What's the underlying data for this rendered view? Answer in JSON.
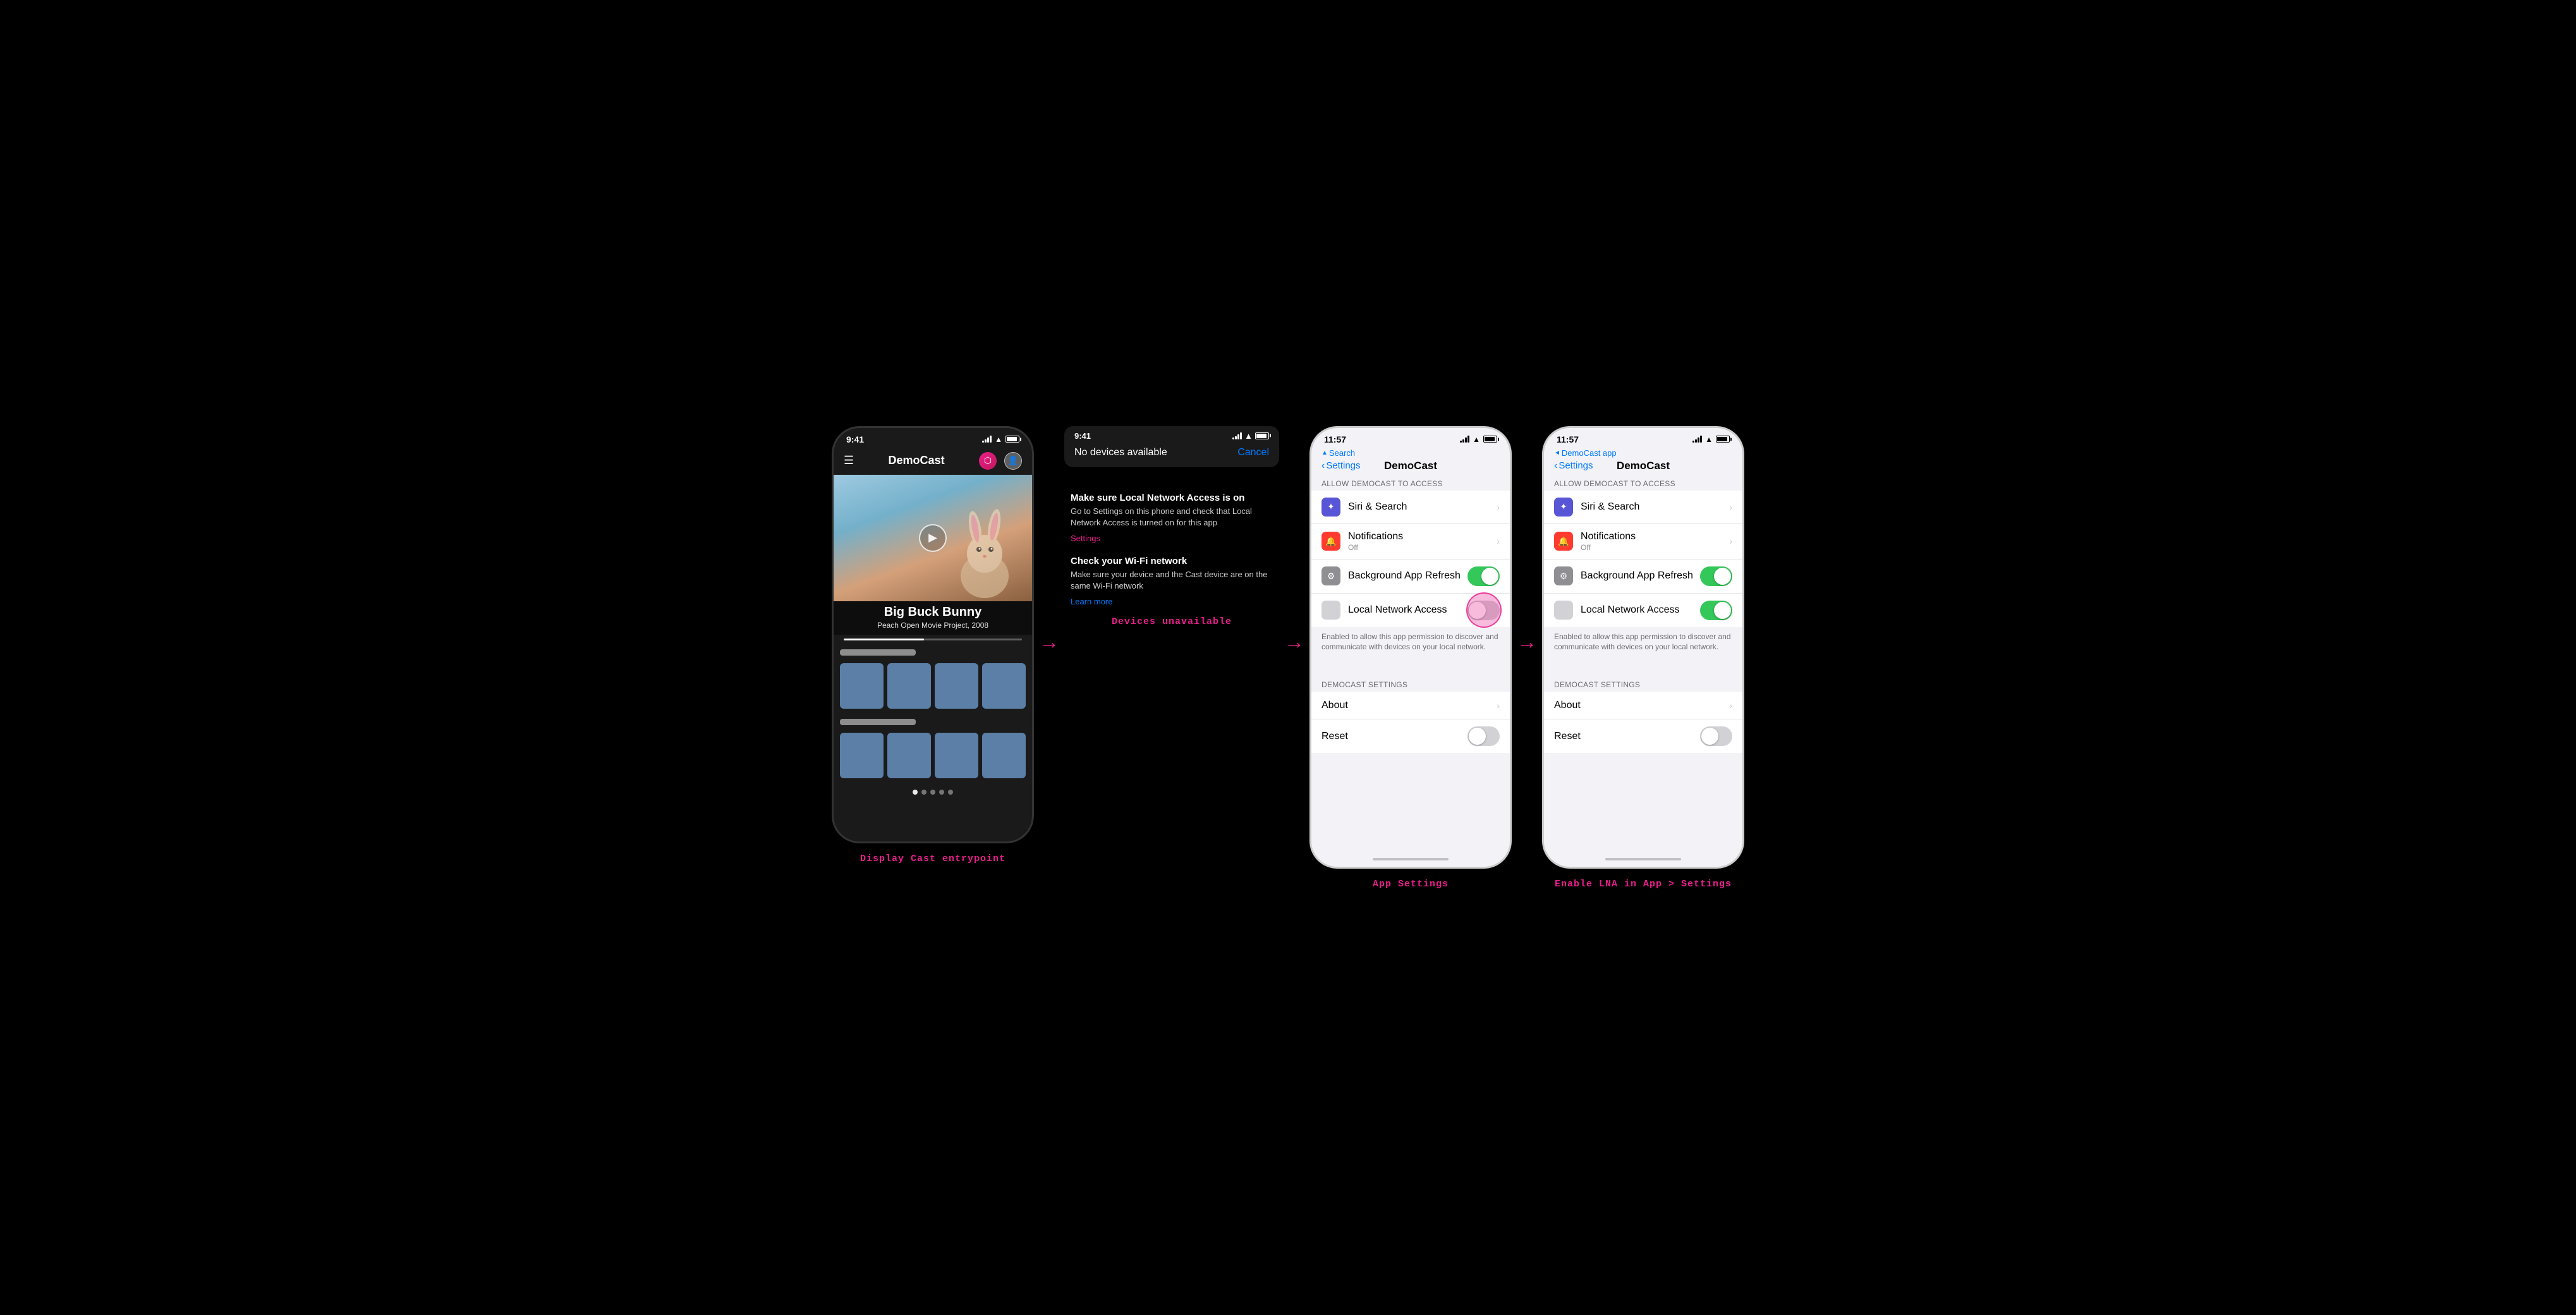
{
  "labels": {
    "col1": "Display Cast entrypoint",
    "col2": "Devices unavailable",
    "col3": "App Settings",
    "col4": "Enable LNA in App > Settings"
  },
  "phone1": {
    "status_time": "9:41",
    "app_name": "DemoCast",
    "movie_title": "Big Buck Bunny",
    "movie_sub": "Peach Open Movie Project, 2008"
  },
  "popup": {
    "status_time": "9:41",
    "no_devices": "No devices available",
    "cancel": "Cancel"
  },
  "instructions": {
    "heading1": "Make sure Local Network Access is on",
    "body1": "Go to Settings on this phone and check that Local Network Access is turned on for this app",
    "link1": "Settings",
    "heading2": "Check your Wi-Fi network",
    "body2": "Make sure your device and the Cast device are on the same Wi-Fi network",
    "link2": "Learn more"
  },
  "settings3": {
    "time": "11:57",
    "back_label": "Search",
    "title": "DemoCast",
    "section1_header": "Allow DemoCast to Access",
    "items": [
      {
        "icon": "🔮",
        "icon_class": "icon-purple",
        "label": "Siri & Search",
        "value": "",
        "type": "chevron"
      },
      {
        "icon": "🔴",
        "icon_class": "icon-red",
        "label": "Notifications",
        "value": "Off",
        "type": "chevron"
      },
      {
        "icon": "⚙️",
        "icon_class": "icon-gray",
        "label": "Background App Refresh",
        "value": "",
        "type": "toggle-on"
      },
      {
        "icon": "◻",
        "icon_class": "icon-light-gray",
        "label": "Local Network Access",
        "value": "",
        "type": "toggle-off",
        "highlighted": true
      }
    ],
    "network_note": "Enabled to allow this app permission to discover and communicate with devices on your local network.",
    "section2_header": "DemoCast Settings",
    "items2": [
      {
        "label": "About",
        "type": "chevron"
      },
      {
        "label": "Reset",
        "type": "toggle-off"
      }
    ]
  },
  "settings4": {
    "time": "11:57",
    "back_label": "DemoCast app",
    "title": "DemoCast",
    "section1_header": "Allow DemoCast to Access",
    "items": [
      {
        "icon": "🔮",
        "icon_class": "icon-purple",
        "label": "Siri & Search",
        "value": "",
        "type": "chevron"
      },
      {
        "icon": "🔴",
        "icon_class": "icon-red",
        "label": "Notifications",
        "value": "Off",
        "type": "chevron"
      },
      {
        "icon": "⚙️",
        "icon_class": "icon-gray",
        "label": "Background App Refresh",
        "value": "",
        "type": "toggle-on"
      },
      {
        "icon": "◻",
        "icon_class": "icon-light-gray",
        "label": "Local Network Access",
        "value": "",
        "type": "toggle-on",
        "highlighted": false
      }
    ],
    "network_note": "Enabled to allow this app permission to discover and communicate with devices on your local network.",
    "section2_header": "DemoCast Settings",
    "items2": [
      {
        "label": "About",
        "type": "chevron"
      },
      {
        "label": "Reset",
        "type": "toggle-off"
      }
    ]
  }
}
